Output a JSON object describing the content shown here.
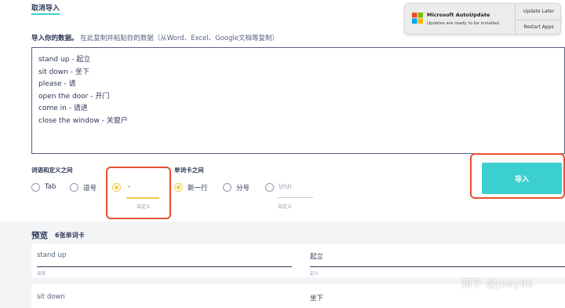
{
  "header": {
    "cancel_import": "取消导入"
  },
  "hint": {
    "title": "导入你的数据。",
    "subtitle": "在此复制并粘贴你的数据（从Word、Excel、Google文档等复制）"
  },
  "data_lines": [
    "stand up - 起立",
    "sit down - 坐下",
    "please - 请",
    "open the door - 开门",
    "come in - 请进",
    "close the window - 关窗户"
  ],
  "term_def_sep": {
    "label": "词语和定义之间",
    "opt_tab": "Tab",
    "opt_comma": "逗号",
    "custom_value": "-",
    "custom_caption": "自定义",
    "selected": "custom"
  },
  "card_sep": {
    "label": "单词卡之间",
    "opt_newline": "新一行",
    "opt_semicolon": "分号",
    "custom_placeholder": "\\n\\n",
    "custom_caption": "自定义",
    "selected": "newline"
  },
  "import_button": "导入",
  "preview": {
    "title": "预览",
    "count": "6张单词卡",
    "cards": [
      {
        "term": "stand up",
        "term_caption": "词语",
        "def": "起立",
        "def_caption": "定义"
      },
      {
        "term": "sit down",
        "def": "坐下"
      }
    ]
  },
  "notification": {
    "title": "Microsoft AutoUpdate",
    "body": "Updates are ready to be installed.",
    "update_later": "Update Later",
    "restart_apps": "Restart Apps"
  },
  "watermark": "知乎 @Joeyde",
  "colors": {
    "accent": "#3ccfcf",
    "radio_on": "#f2c94c",
    "highlight": "#e8502f"
  }
}
